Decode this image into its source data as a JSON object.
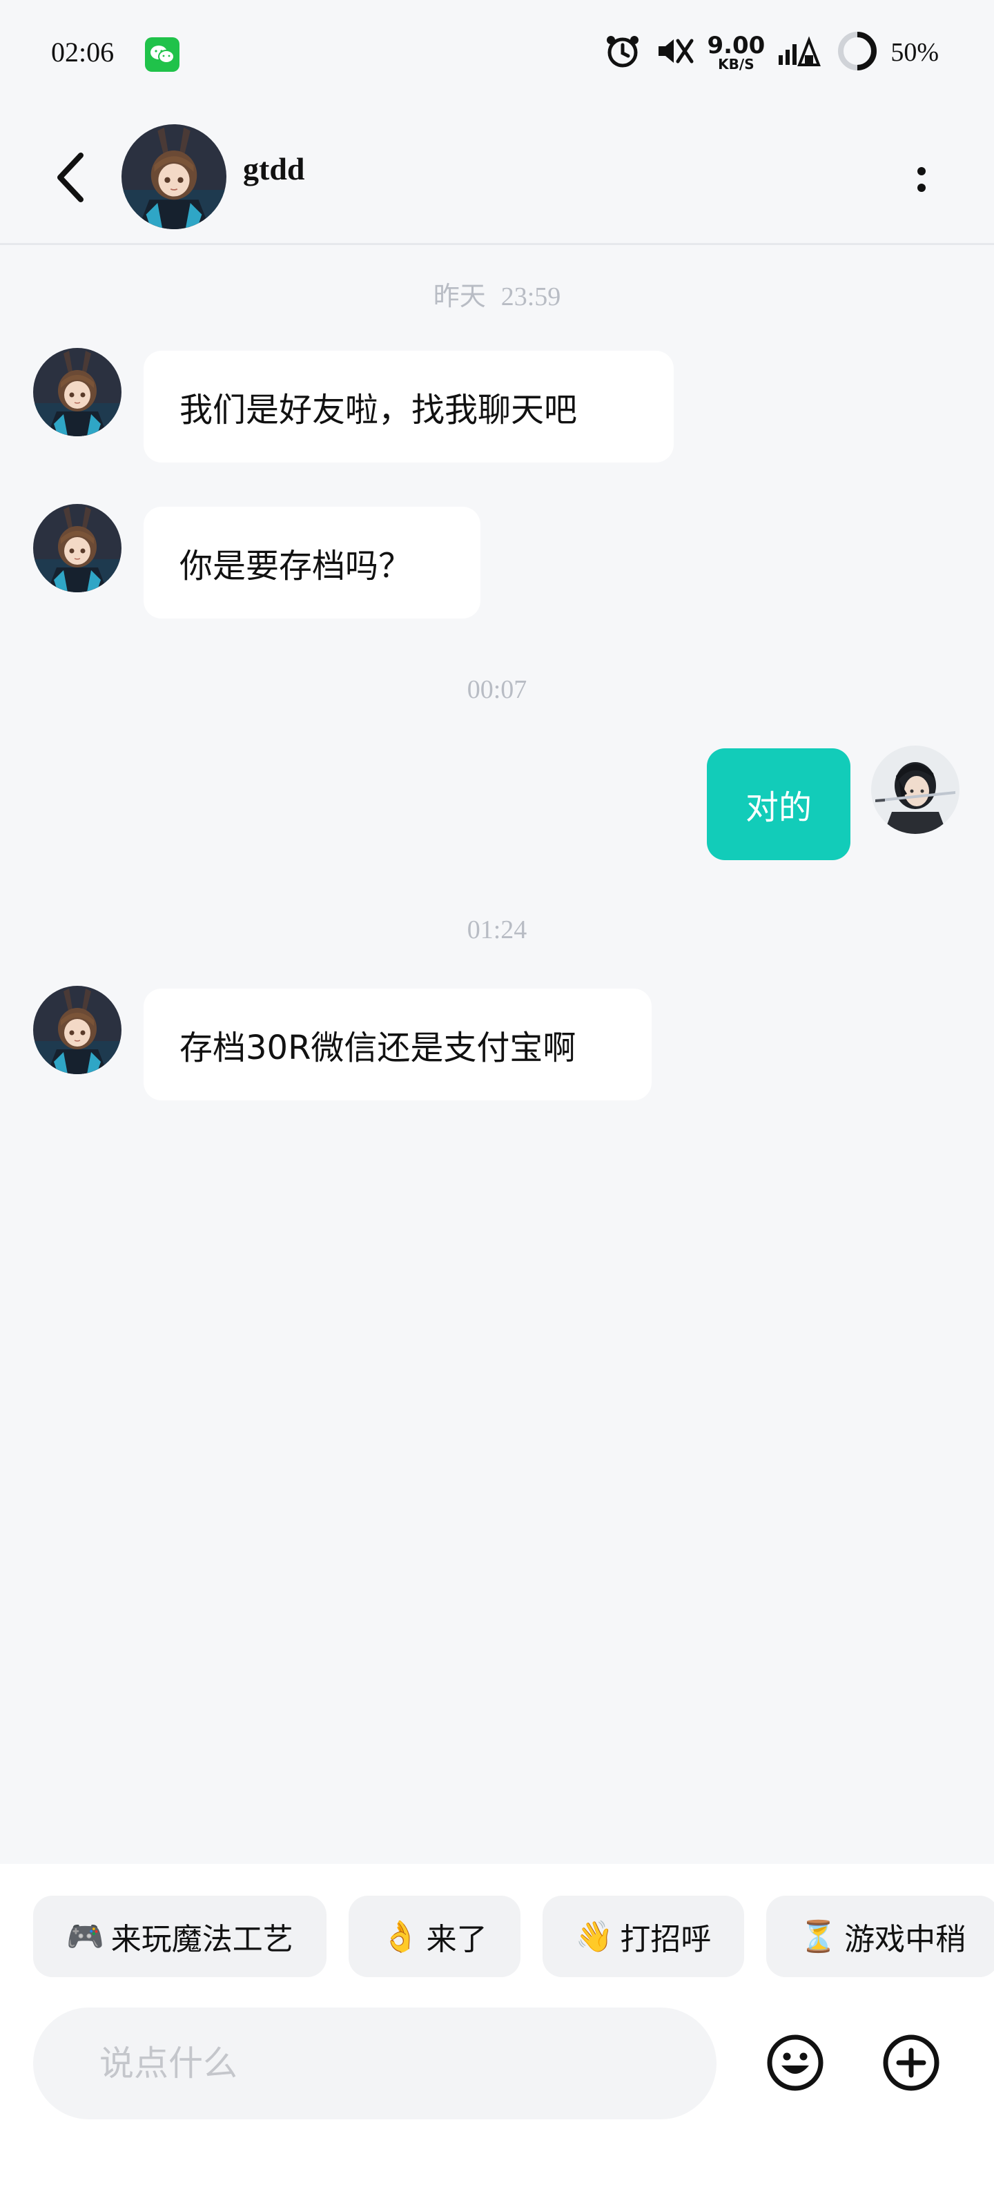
{
  "status_bar": {
    "time": "02:06",
    "net_speed": "9.00",
    "net_speed_unit": "KB/S",
    "battery": "50%",
    "icons": [
      "wechat-icon",
      "alarm-icon",
      "mute-icon",
      "nfc-icon",
      "signal-icon",
      "battery-icon"
    ]
  },
  "header": {
    "contact_name": "gtdd",
    "avatar": "anime-girl-bunny-ears-avatar",
    "back_icon": "chevron-left-icon",
    "more_icon": "vertical-dots-icon"
  },
  "messages": [
    {
      "type": "timestamp",
      "date": "昨天",
      "time": "23:59"
    },
    {
      "type": "message",
      "from": "gtdd",
      "text": "我们是好友啦，找我聊天吧"
    },
    {
      "type": "message",
      "from": "gtdd",
      "text": "你是要存档吗？"
    },
    {
      "type": "timestamp",
      "time": "00:07"
    },
    {
      "type": "message",
      "from": "me",
      "text": "对的"
    },
    {
      "type": "timestamp",
      "time": "01:24"
    },
    {
      "type": "message",
      "from": "gtdd",
      "text": "存档30R微信还是支付宝啊"
    }
  ],
  "quick_replies": [
    {
      "emoji": "🎮",
      "label": "来玩魔法工艺"
    },
    {
      "emoji": "👌",
      "label": "来了"
    },
    {
      "emoji": "👋",
      "label": "打招呼"
    },
    {
      "emoji": "⏳",
      "label": "游戏中稍"
    }
  ],
  "composer": {
    "placeholder": "说点什么",
    "value": "",
    "emoji_icon": "smiley-face-icon",
    "plus_icon": "add-circle-icon"
  }
}
